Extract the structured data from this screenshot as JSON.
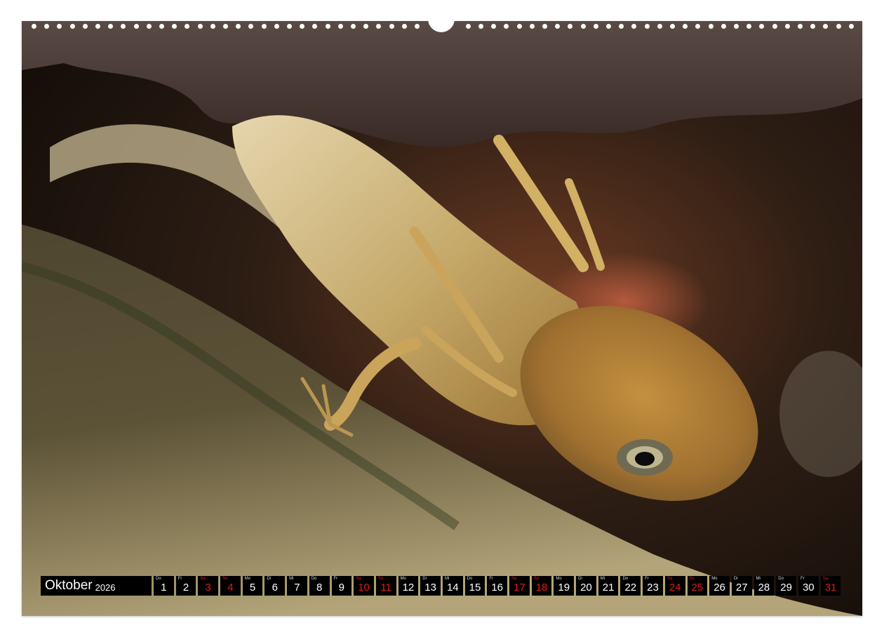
{
  "calendar": {
    "month": "Oktober",
    "year": "2026",
    "days": [
      {
        "d": "1",
        "wd": "Do",
        "we": false
      },
      {
        "d": "2",
        "wd": "Fr",
        "we": false
      },
      {
        "d": "3",
        "wd": "Sa",
        "we": true
      },
      {
        "d": "4",
        "wd": "So",
        "we": true
      },
      {
        "d": "5",
        "wd": "Mo",
        "we": false
      },
      {
        "d": "6",
        "wd": "Di",
        "we": false
      },
      {
        "d": "7",
        "wd": "Mi",
        "we": false
      },
      {
        "d": "8",
        "wd": "Do",
        "we": false
      },
      {
        "d": "9",
        "wd": "Fr",
        "we": false
      },
      {
        "d": "10",
        "wd": "Sa",
        "we": true
      },
      {
        "d": "11",
        "wd": "So",
        "we": true
      },
      {
        "d": "12",
        "wd": "Mo",
        "we": false
      },
      {
        "d": "13",
        "wd": "Di",
        "we": false
      },
      {
        "d": "14",
        "wd": "Mi",
        "we": false
      },
      {
        "d": "15",
        "wd": "Do",
        "we": false
      },
      {
        "d": "16",
        "wd": "Fr",
        "we": false
      },
      {
        "d": "17",
        "wd": "Sa",
        "we": true
      },
      {
        "d": "18",
        "wd": "So",
        "we": true
      },
      {
        "d": "19",
        "wd": "Mo",
        "we": false
      },
      {
        "d": "20",
        "wd": "Di",
        "we": false
      },
      {
        "d": "21",
        "wd": "Mi",
        "we": false
      },
      {
        "d": "22",
        "wd": "Do",
        "we": false
      },
      {
        "d": "23",
        "wd": "Fr",
        "we": false
      },
      {
        "d": "24",
        "wd": "Sa",
        "we": true
      },
      {
        "d": "25",
        "wd": "So",
        "we": true
      },
      {
        "d": "26",
        "wd": "Mo",
        "we": false
      },
      {
        "d": "27",
        "wd": "Di",
        "we": false
      },
      {
        "d": "28",
        "wd": "Mi",
        "we": false
      },
      {
        "d": "29",
        "wd": "Do",
        "we": false
      },
      {
        "d": "30",
        "wd": "Fr",
        "we": false
      },
      {
        "d": "31",
        "wd": "Sa",
        "we": true
      }
    ]
  },
  "colors": {
    "weekend": "#e01a1a",
    "cell_bg": "#000000",
    "text": "#ffffff"
  }
}
